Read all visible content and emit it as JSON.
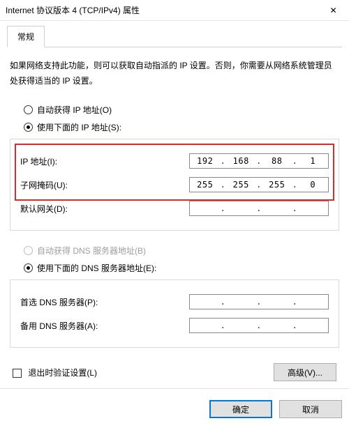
{
  "window": {
    "title": "Internet 协议版本 4 (TCP/IPv4) 属性"
  },
  "tabs": {
    "general": "常规"
  },
  "description": "如果网络支持此功能，则可以获取自动指派的 IP 设置。否则，你需要从网络系统管理员处获得适当的 IP 设置。",
  "ip_section": {
    "auto_label": "自动获得 IP 地址(O)",
    "manual_label": "使用下面的 IP 地址(S):",
    "fields": {
      "ip_label": "IP 地址(I):",
      "ip_value": {
        "o1": "192",
        "o2": "168",
        "o3": "88",
        "o4": "1"
      },
      "mask_label": "子网掩码(U):",
      "mask_value": {
        "o1": "255",
        "o2": "255",
        "o3": "255",
        "o4": "0"
      },
      "gateway_label": "默认网关(D):",
      "gateway_value": {
        "o1": "",
        "o2": "",
        "o3": "",
        "o4": ""
      }
    }
  },
  "dns_section": {
    "auto_label": "自动获得 DNS 服务器地址(B)",
    "manual_label": "使用下面的 DNS 服务器地址(E):",
    "fields": {
      "pref_label": "首选 DNS 服务器(P):",
      "pref_value": {
        "o1": "",
        "o2": "",
        "o3": "",
        "o4": ""
      },
      "alt_label": "备用 DNS 服务器(A):",
      "alt_value": {
        "o1": "",
        "o2": "",
        "o3": "",
        "o4": ""
      }
    }
  },
  "validate_label": "退出时验证设置(L)",
  "advanced_label": "高级(V)...",
  "buttons": {
    "ok": "确定",
    "cancel": "取消"
  }
}
